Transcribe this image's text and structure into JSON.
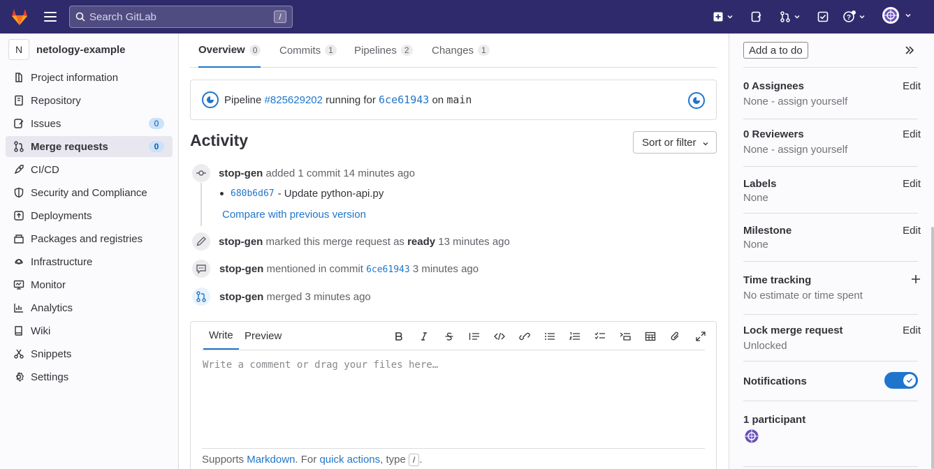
{
  "topbar": {
    "search_placeholder": "Search GitLab",
    "search_shortcut": "/"
  },
  "sidebar": {
    "project_initial": "N",
    "project_name": "netology-example",
    "items": [
      {
        "label": "Project information",
        "icon": "project-icon"
      },
      {
        "label": "Repository",
        "icon": "repository-icon"
      },
      {
        "label": "Issues",
        "icon": "issues-icon",
        "count": "0"
      },
      {
        "label": "Merge requests",
        "icon": "merge-request-icon",
        "count": "0",
        "active": true
      },
      {
        "label": "CI/CD",
        "icon": "rocket-icon"
      },
      {
        "label": "Security and Compliance",
        "icon": "shield-icon"
      },
      {
        "label": "Deployments",
        "icon": "deployments-icon"
      },
      {
        "label": "Packages and registries",
        "icon": "package-icon"
      },
      {
        "label": "Infrastructure",
        "icon": "cloud-gear-icon"
      },
      {
        "label": "Monitor",
        "icon": "monitor-icon"
      },
      {
        "label": "Analytics",
        "icon": "chart-icon"
      },
      {
        "label": "Wiki",
        "icon": "book-icon"
      },
      {
        "label": "Snippets",
        "icon": "snippet-icon"
      },
      {
        "label": "Settings",
        "icon": "gear-icon"
      }
    ]
  },
  "tabs": [
    {
      "label": "Overview",
      "count": "0",
      "active": true
    },
    {
      "label": "Commits",
      "count": "1"
    },
    {
      "label": "Pipelines",
      "count": "2"
    },
    {
      "label": "Changes",
      "count": "1"
    }
  ],
  "pipeline": {
    "prefix": "Pipeline",
    "id": "#825629202",
    "middle": "running for",
    "commit": "6ce61943",
    "on": "on",
    "branch": "main"
  },
  "activity": {
    "title": "Activity",
    "sort_label": "Sort or filter",
    "events": [
      {
        "user": "stop-gen",
        "action": "added 1 commit",
        "time": "14 minutes ago",
        "icon": "commit-icon"
      },
      {
        "user": "stop-gen",
        "action_pre": "marked this merge request as",
        "action_strong": "ready",
        "time": "13 minutes ago",
        "icon": "pencil-icon"
      },
      {
        "user": "stop-gen",
        "action": "mentioned in commit",
        "commit": "6ce61943",
        "time": "3 minutes ago",
        "icon": "comment-icon"
      },
      {
        "user": "stop-gen",
        "action": "merged",
        "time": "3 minutes ago",
        "icon": "merge-icon"
      }
    ],
    "commit_sha": "680b6d67",
    "commit_message": "- Update python-api.py",
    "compare_link": "Compare with previous version"
  },
  "editor": {
    "write_tab": "Write",
    "preview_tab": "Preview",
    "placeholder": "Write a comment or drag your files here…",
    "footer_prefix": "Supports",
    "markdown_link": "Markdown",
    "footer_mid": ". For",
    "quick_actions_link": "quick actions",
    "footer_type": ", type",
    "footer_key": "/",
    "footer_end": "."
  },
  "right_sidebar": {
    "todo_label": "Add a to do",
    "assignees_title": "0 Assignees",
    "assignees_value": "None - assign yourself",
    "reviewers_title": "0 Reviewers",
    "reviewers_value": "None - assign yourself",
    "labels_title": "Labels",
    "labels_value": "None",
    "milestone_title": "Milestone",
    "milestone_value": "None",
    "time_title": "Time tracking",
    "time_value": "No estimate or time spent",
    "lock_title": "Lock merge request",
    "lock_value": "Unlocked",
    "notifications_title": "Notifications",
    "notifications_on": true,
    "participants_title": "1 participant",
    "edit_label": "Edit"
  },
  "colors": {
    "topbar": "#2f2a6b",
    "link": "#1f75cb",
    "badge_bg": "#cbe2f9"
  }
}
